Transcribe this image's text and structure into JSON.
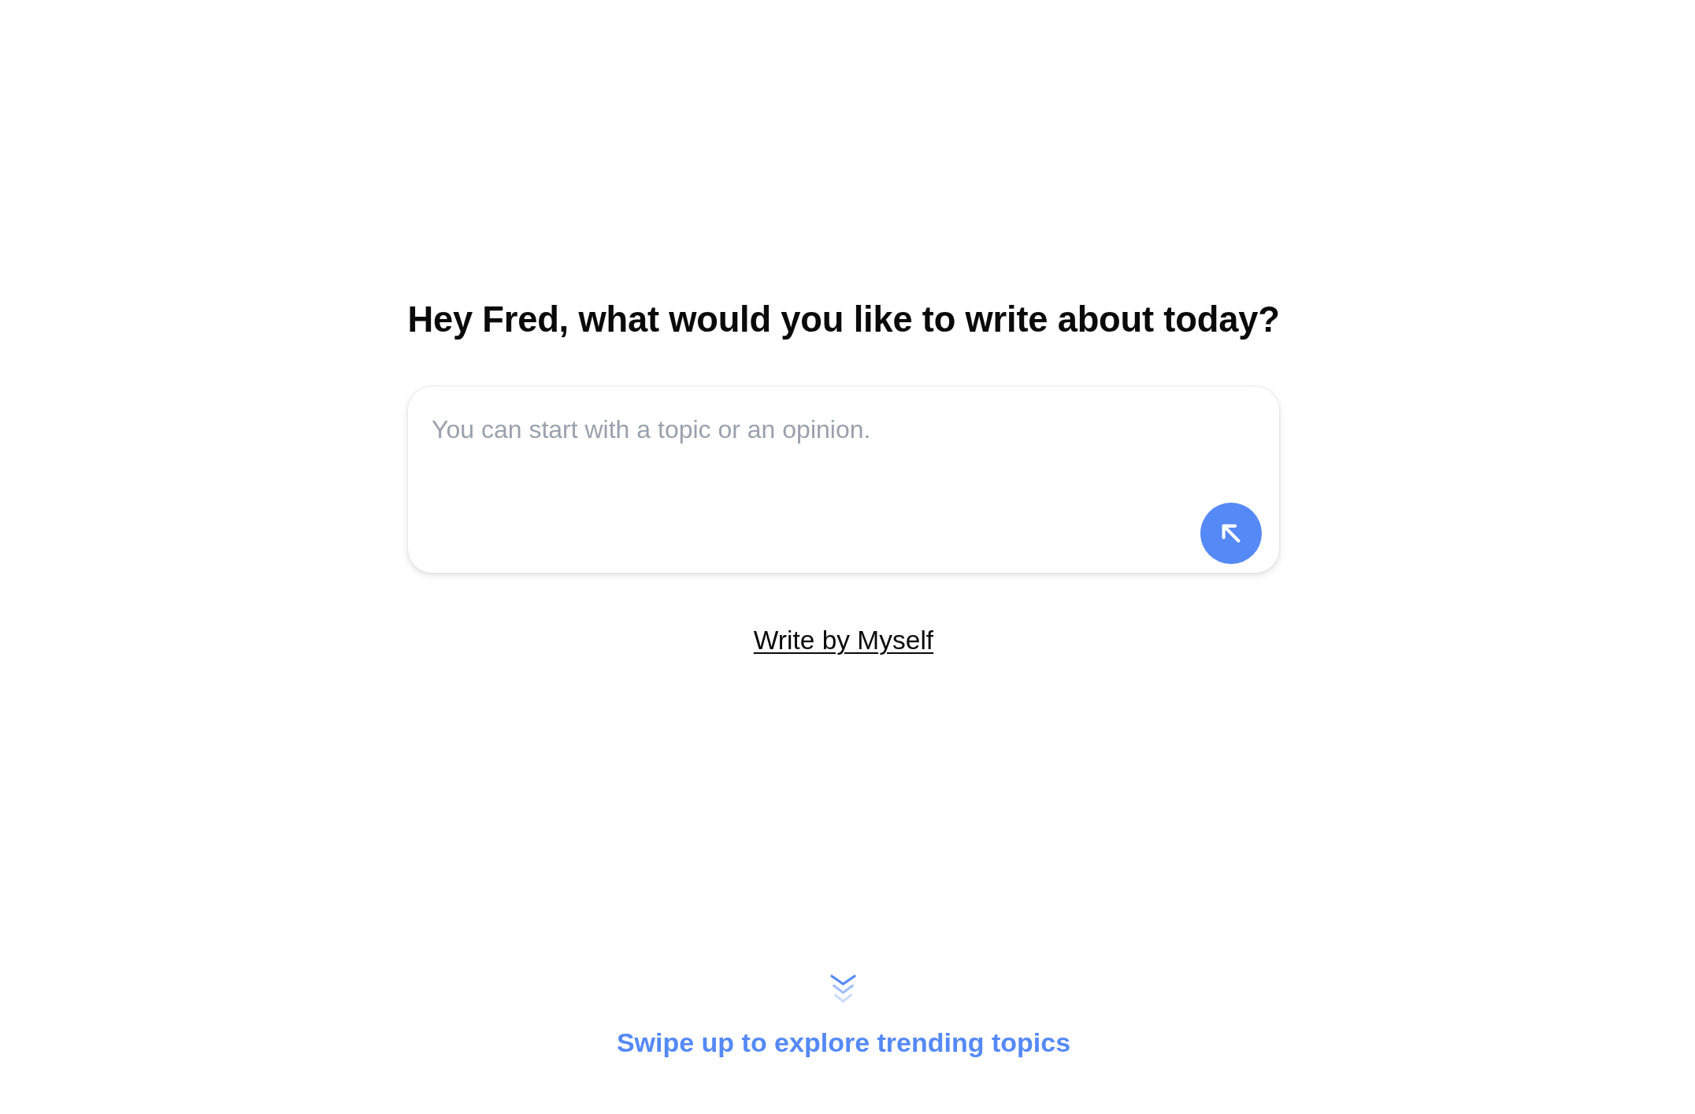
{
  "heading": "Hey Fred, what would you like to write about today?",
  "composer": {
    "placeholder": "You can start with a topic or an opinion."
  },
  "write_link": "Write by Myself",
  "footer": {
    "hint": "Swipe up to explore trending topics"
  }
}
